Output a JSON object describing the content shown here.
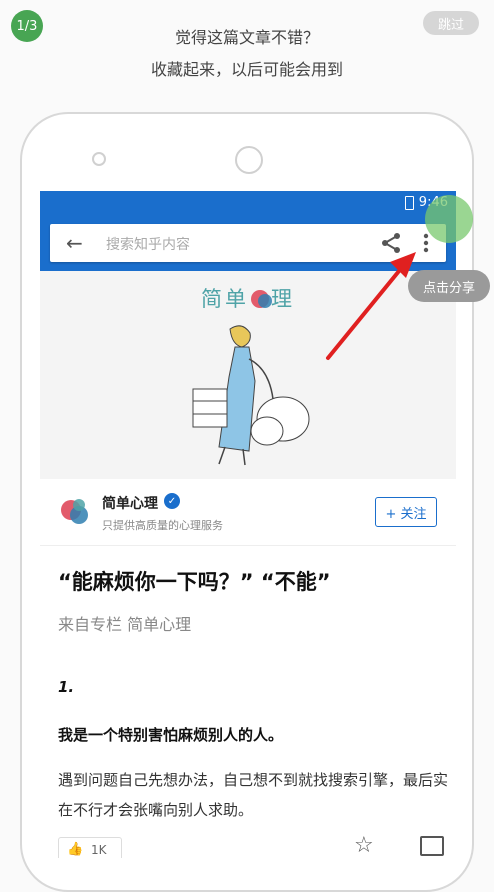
{
  "guide": {
    "step": "1/3",
    "skip_label": "跳过",
    "line1": "觉得这篇文章不错？",
    "line2": "收藏起来，以后可能会用到",
    "tooltip": "点击分享"
  },
  "phone": {
    "status_time": "9:46",
    "search_placeholder": "搜索知乎内容",
    "banner_brand_left": "简单",
    "banner_brand_right": "理",
    "author_name": "简单心理",
    "author_bio": "只提供高质量的心理服务",
    "follow_label": "+ 关注",
    "article_title": "“能麻烦你一下吗？” “不能”",
    "source": "来自专栏 简单心理",
    "section_number": "1.",
    "lead_sentence": "我是一个特别害怕麻烦别人的人。",
    "paragraph": "遇到问题自己先想办法，自己想不到就找搜索引擎，最后实在不行才会张嘴向别人求助。",
    "like_count": "1K"
  },
  "colors": {
    "accent": "#1a6ecc",
    "step_badge": "#48a553",
    "arrow": "#e02020"
  }
}
